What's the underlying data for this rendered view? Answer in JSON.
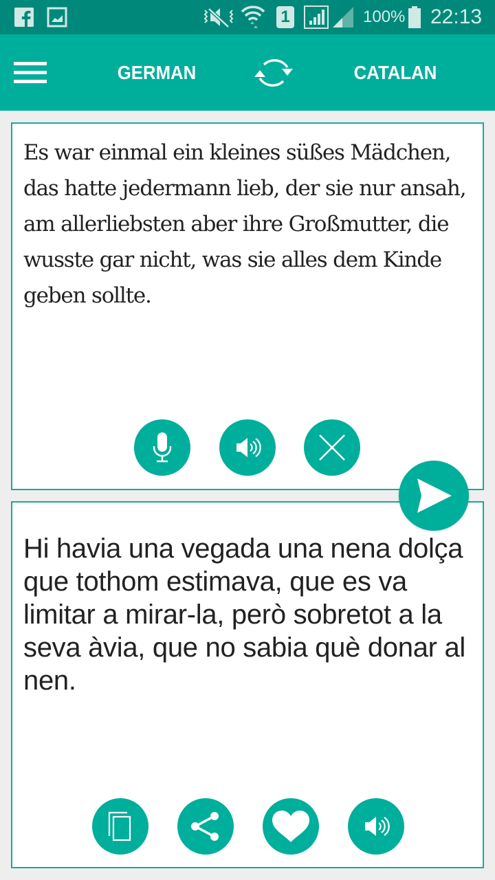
{
  "status_bar": {
    "notification_icons": [
      "facebook-icon",
      "image-icon"
    ],
    "system_icons": [
      "vibrate-mute-icon",
      "wifi-icon",
      "sim-1-icon",
      "signal-icon",
      "signal-icon"
    ],
    "sim_label": "1",
    "battery_percent": "100%",
    "time": "22:13"
  },
  "app_bar": {
    "source_language": "GERMAN",
    "target_language": "CATALAN",
    "menu_icon": "menu-icon",
    "swap_icon": "swap-languages-icon"
  },
  "source_panel": {
    "text": "Es war einmal ein kleines süßes Mädchen, das hatte jedermann lieb, der sie nur ansah, am allerliebsten aber ihre Großmutter, die wusste gar nicht, was sie alles dem Kinde geben sollte.",
    "actions": [
      {
        "name": "microphone",
        "icon": "microphone-icon"
      },
      {
        "name": "speak",
        "icon": "speaker-icon"
      },
      {
        "name": "clear",
        "icon": "close-icon"
      }
    ]
  },
  "translate_button": {
    "icon": "send-icon"
  },
  "target_panel": {
    "text": "Hi havia una vegada una nena dolça que tothom estimava, que es va limitar a mirar-la, però sobretot a la seva àvia, que no sabia què donar al nen.",
    "actions": [
      {
        "name": "copy",
        "icon": "copy-icon"
      },
      {
        "name": "share",
        "icon": "share-icon"
      },
      {
        "name": "favorite",
        "icon": "heart-icon"
      },
      {
        "name": "speak",
        "icon": "speaker-icon"
      }
    ]
  },
  "colors": {
    "status_bar": "#00897b",
    "primary": "#00ae9c",
    "panel_border": "#1aa898",
    "background": "#eeeeee"
  }
}
